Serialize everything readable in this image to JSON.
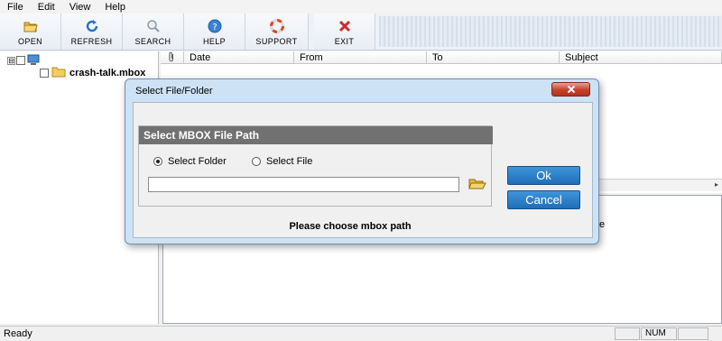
{
  "menu": [
    "File",
    "Edit",
    "View",
    "Help"
  ],
  "toolbar": {
    "open": "OPEN",
    "refresh": "REFRESH",
    "search": "SEARCH",
    "help": "HELP",
    "support": "SUPPORT",
    "exit": "EXIT"
  },
  "tree": {
    "root_expander": "⊟",
    "item_label": "crash-talk.mbox"
  },
  "list": {
    "columns": [
      "Date",
      "From",
      "To",
      "Subject"
    ]
  },
  "preview": {
    "fragment": "e"
  },
  "status": {
    "text": "Ready",
    "num": "NUM"
  },
  "dialog": {
    "title": "Select File/Folder",
    "group_title": "Select MBOX File Path",
    "option_folder": "Select Folder",
    "option_file": "Select File",
    "selected_option": "Select Folder",
    "path_value": "",
    "ok": "Ok",
    "cancel": "Cancel",
    "message": "Please choose mbox path"
  },
  "colors": {
    "dialog_button": "#2a7fc6",
    "group_header": "#717171",
    "close_button": "#c7402b"
  }
}
